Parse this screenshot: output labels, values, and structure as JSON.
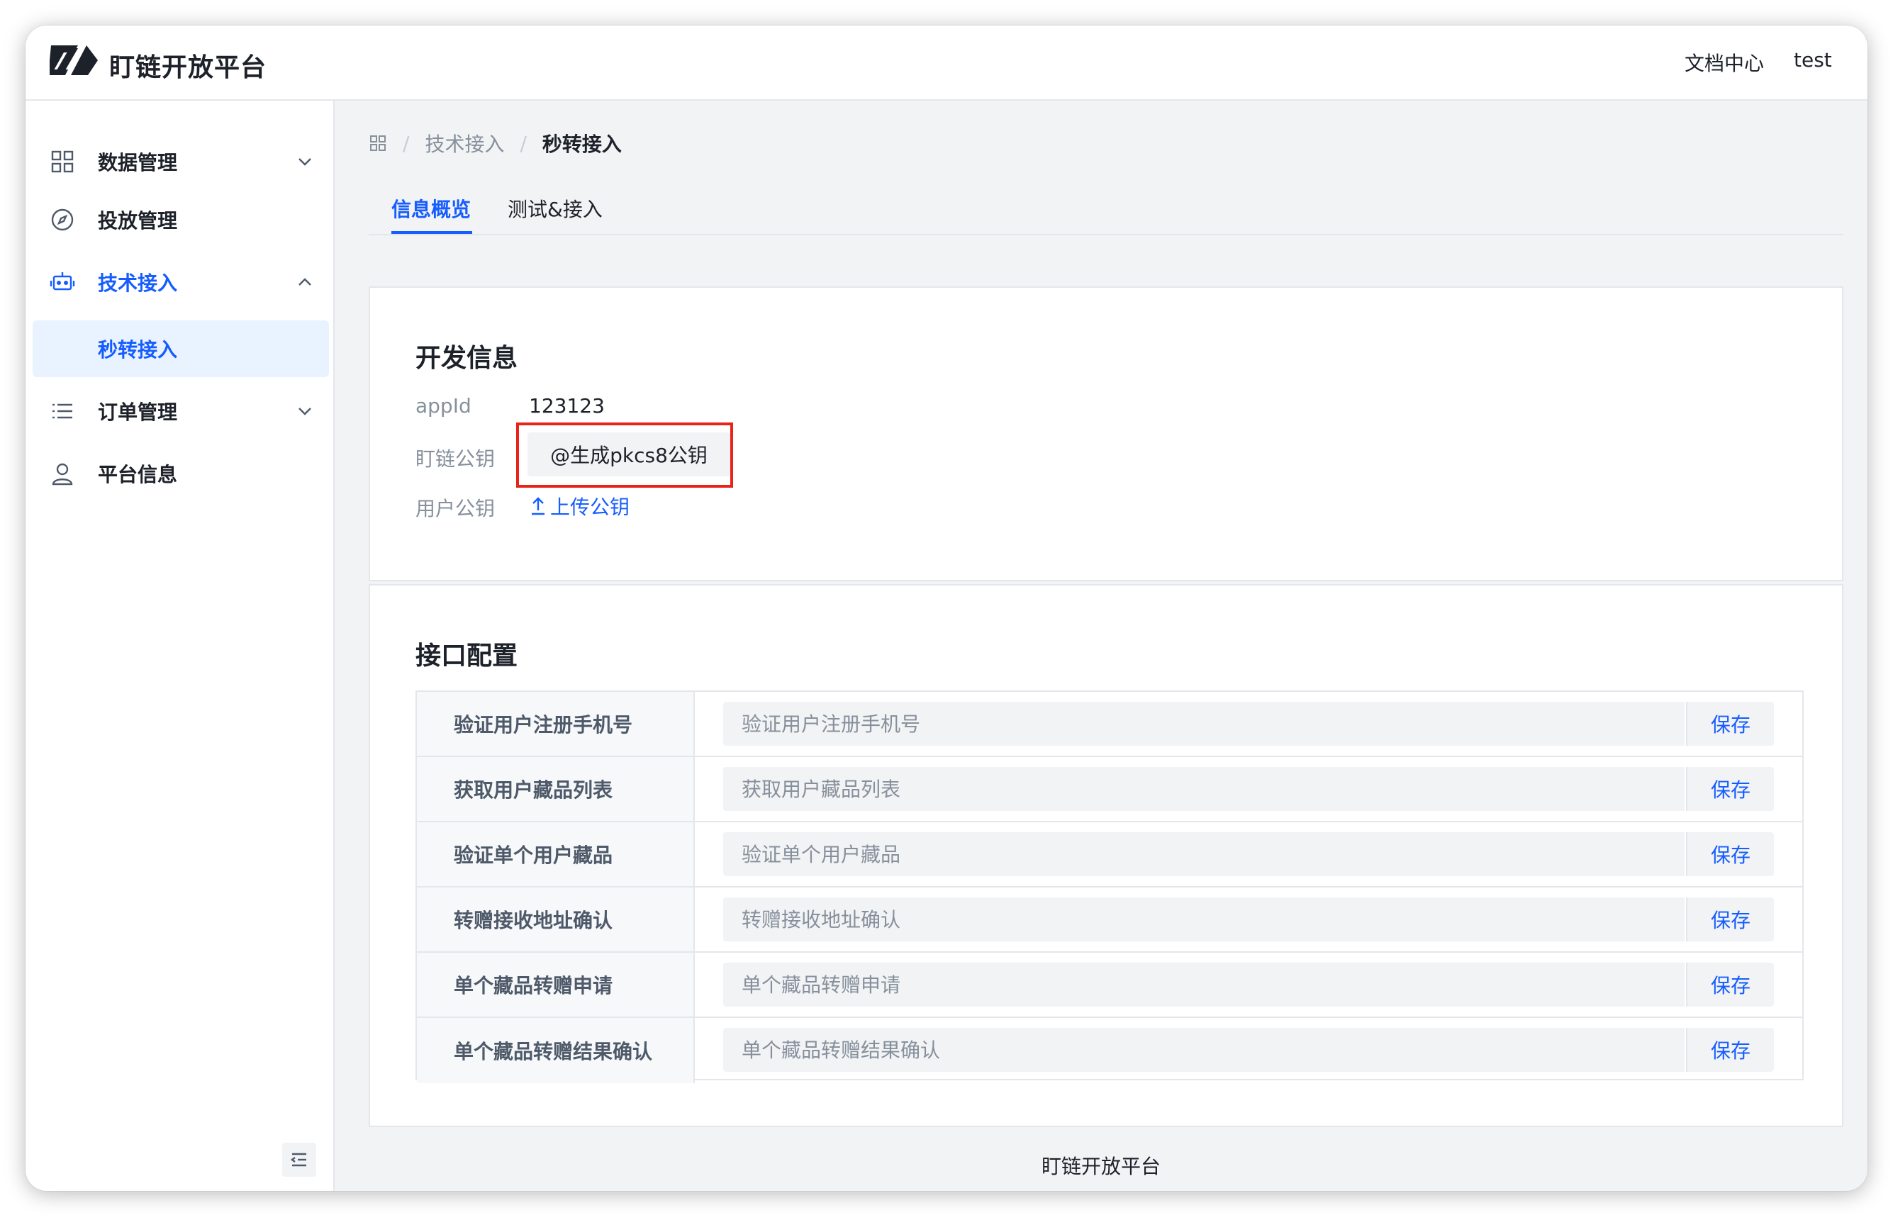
{
  "header": {
    "brand": "盯链开放平台",
    "doc_center": "文档中心",
    "user": "test"
  },
  "sidebar": {
    "items": [
      {
        "label": "数据管理",
        "icon": "grid-icon"
      },
      {
        "label": "投放管理",
        "icon": "compass-icon"
      },
      {
        "label": "技术接入",
        "icon": "robot-icon"
      },
      {
        "label": "秒转接入",
        "icon": ""
      },
      {
        "label": "订单管理",
        "icon": "list-icon"
      },
      {
        "label": "平台信息",
        "icon": "user-icon"
      }
    ]
  },
  "breadcrumb": {
    "level1": "技术接入",
    "level2": "秒转接入"
  },
  "tabs": [
    {
      "label": "信息概览",
      "active": true
    },
    {
      "label": "测试&接入",
      "active": false
    }
  ],
  "dev_info": {
    "title": "开发信息",
    "appid_label": "appId",
    "appid_value": "123123",
    "platform_key_label": "盯链公钥",
    "generate_button": "@生成pkcs8公钥",
    "user_key_label": "用户公钥",
    "upload_link": "上传公钥"
  },
  "api_config": {
    "title": "接口配置",
    "save_label": "保存",
    "rows": [
      {
        "name": "验证用户注册手机号",
        "placeholder": "验证用户注册手机号"
      },
      {
        "name": "获取用户藏品列表",
        "placeholder": "获取用户藏品列表"
      },
      {
        "name": "验证单个用户藏品",
        "placeholder": "验证单个用户藏品"
      },
      {
        "name": "转赠接收地址确认",
        "placeholder": "转赠接收地址确认"
      },
      {
        "name": "单个藏品转赠申请",
        "placeholder": "单个藏品转赠申请"
      },
      {
        "name": "单个藏品转赠结果确认",
        "placeholder": "单个藏品转赠结果确认"
      }
    ]
  },
  "footer": {
    "text": "盯链开放平台"
  },
  "colors": {
    "primary": "#165dff",
    "highlight_box": "#e8241a"
  }
}
